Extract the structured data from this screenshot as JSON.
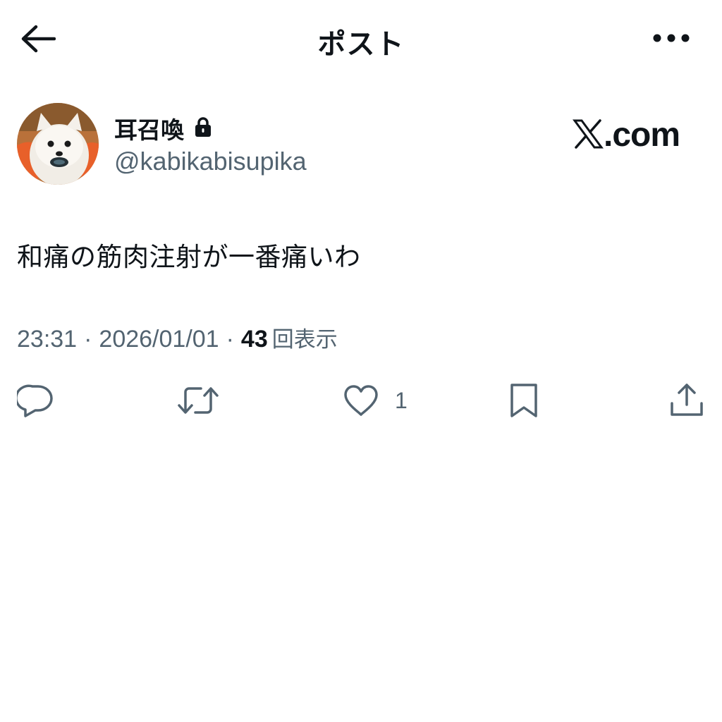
{
  "header": {
    "title": "ポスト",
    "back_icon": "arrow-left-icon",
    "more_icon": "more-horizontal-icon"
  },
  "author": {
    "display_name": "耳召喚",
    "handle": "@kabikabisupika",
    "protected_icon": "lock-icon",
    "avatar": "pomeranian-dog-avatar"
  },
  "brand": {
    "text": ".com",
    "logo_icon": "x-logo-icon"
  },
  "post": {
    "text": "和痛の筋肉注射が一番痛いわ"
  },
  "meta": {
    "time": "23:31",
    "separator1": "·",
    "date": "2026/01/01",
    "separator2": "·",
    "views_count": "43",
    "views_label": "回表示"
  },
  "actions": {
    "reply_icon": "reply-icon",
    "repost_icon": "repost-icon",
    "like_icon": "heart-icon",
    "like_count": "1",
    "bookmark_icon": "bookmark-icon",
    "share_icon": "share-icon"
  },
  "colors": {
    "text_primary": "#0f1419",
    "text_secondary": "#536471",
    "background": "#ffffff"
  }
}
